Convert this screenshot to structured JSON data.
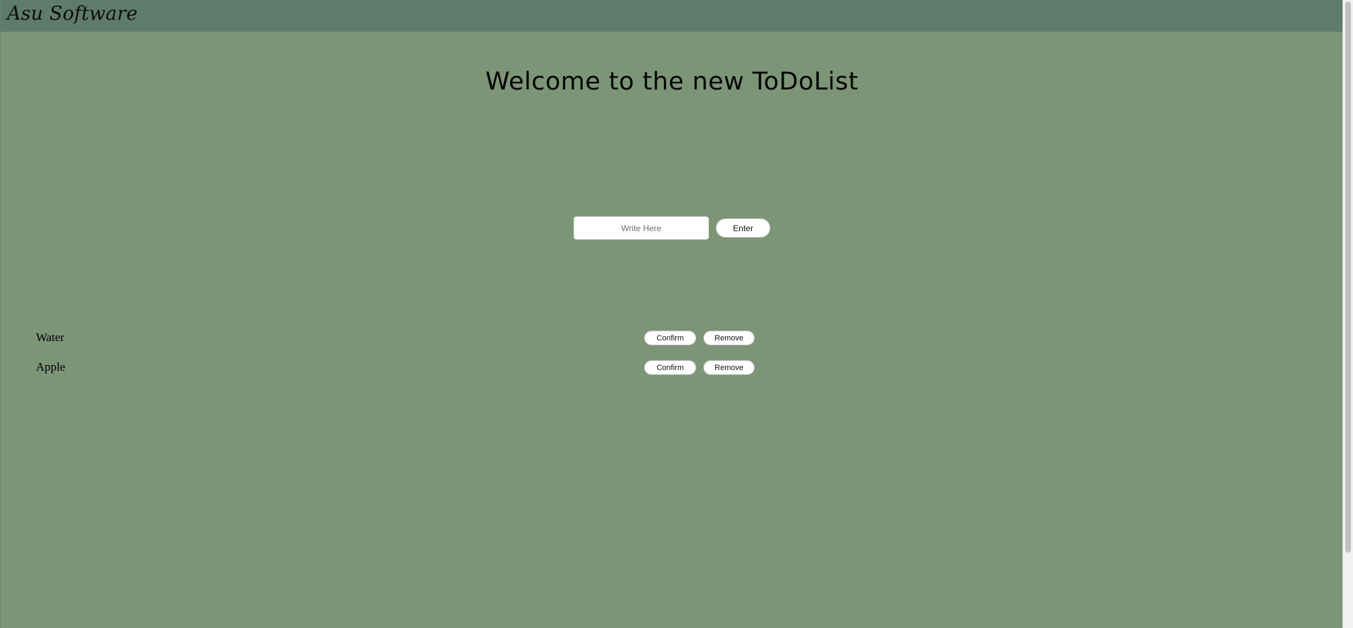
{
  "navbar": {
    "brand": "Asu Software"
  },
  "main": {
    "title": "Welcome to the new ToDoList",
    "input": {
      "placeholder": "Write Here",
      "value": ""
    },
    "enter_label": "Enter"
  },
  "todos": [
    {
      "text": "Water",
      "confirm_label": "Confirm",
      "remove_label": "Remove"
    },
    {
      "text": "Apple",
      "confirm_label": "Confirm",
      "remove_label": "Remove"
    }
  ],
  "colors": {
    "page_background": "#7d9577",
    "navbar_background": "#5e7b6c",
    "button_background": "#ffffff"
  }
}
